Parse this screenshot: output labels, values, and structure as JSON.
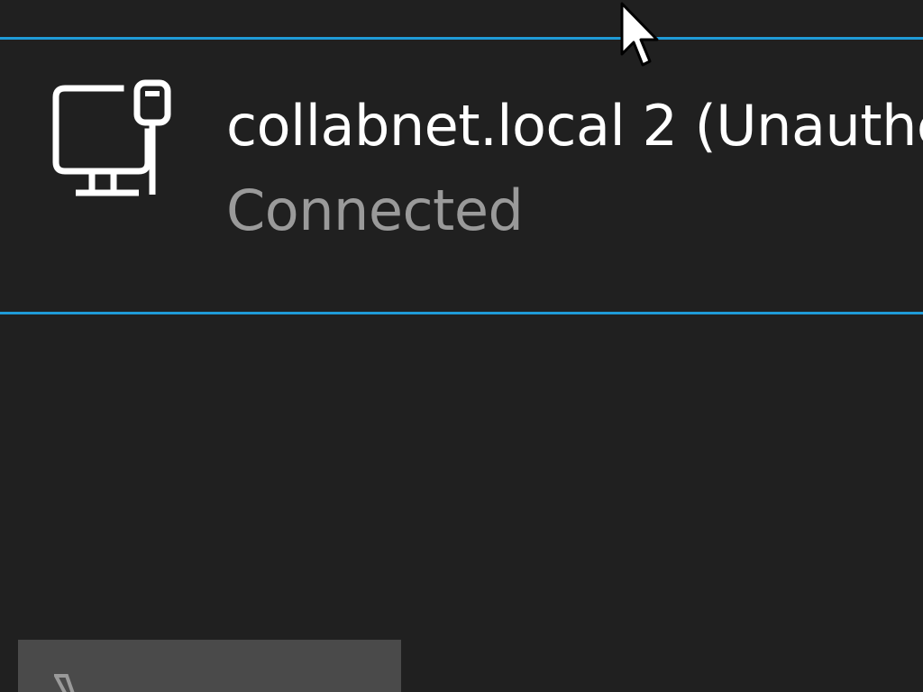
{
  "network": {
    "name": "collabnet.local 2 (Unauthe",
    "status": "Connected",
    "icon": "ethernet-network-icon",
    "accent_color": "#1f9bd7"
  },
  "bottom_button": {
    "icon": "airplane-icon"
  },
  "colors": {
    "background": "#202020",
    "name_text": "#ffffff",
    "status_text": "#9a9a9a",
    "button_bg": "#4a4a4a"
  }
}
